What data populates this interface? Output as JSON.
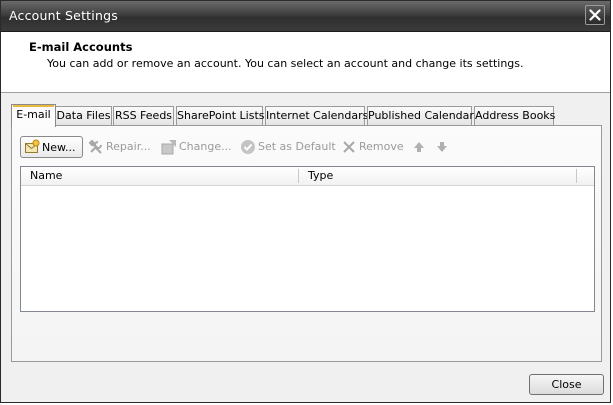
{
  "window": {
    "title": "Account Settings"
  },
  "header": {
    "title": "E-mail Accounts",
    "subtitle": "You can add or remove an account. You can select an account and change its settings."
  },
  "tabs": [
    {
      "label": "E-mail",
      "active": true
    },
    {
      "label": "Data Files"
    },
    {
      "label": "RSS Feeds"
    },
    {
      "label": "SharePoint Lists"
    },
    {
      "label": "Internet Calendars"
    },
    {
      "label": "Published Calendars"
    },
    {
      "label": "Address Books"
    }
  ],
  "toolbar": {
    "new_label": "New...",
    "repair_label": "Repair...",
    "change_label": "Change...",
    "set_default_label": "Set as Default",
    "remove_label": "Remove",
    "icons": {
      "new": "new-account-icon",
      "repair": "repair-tools-icon",
      "change": "change-icon",
      "set_default": "checkmark-icon",
      "remove": "x-icon",
      "up": "arrow-up-icon",
      "down": "arrow-down-icon"
    }
  },
  "list": {
    "columns": [
      "Name",
      "Type"
    ],
    "rows": []
  },
  "footer": {
    "close_label": "Close"
  },
  "colors": {
    "titlebar": "#3a3a3a",
    "active_tab_mark": "#e8b840"
  }
}
